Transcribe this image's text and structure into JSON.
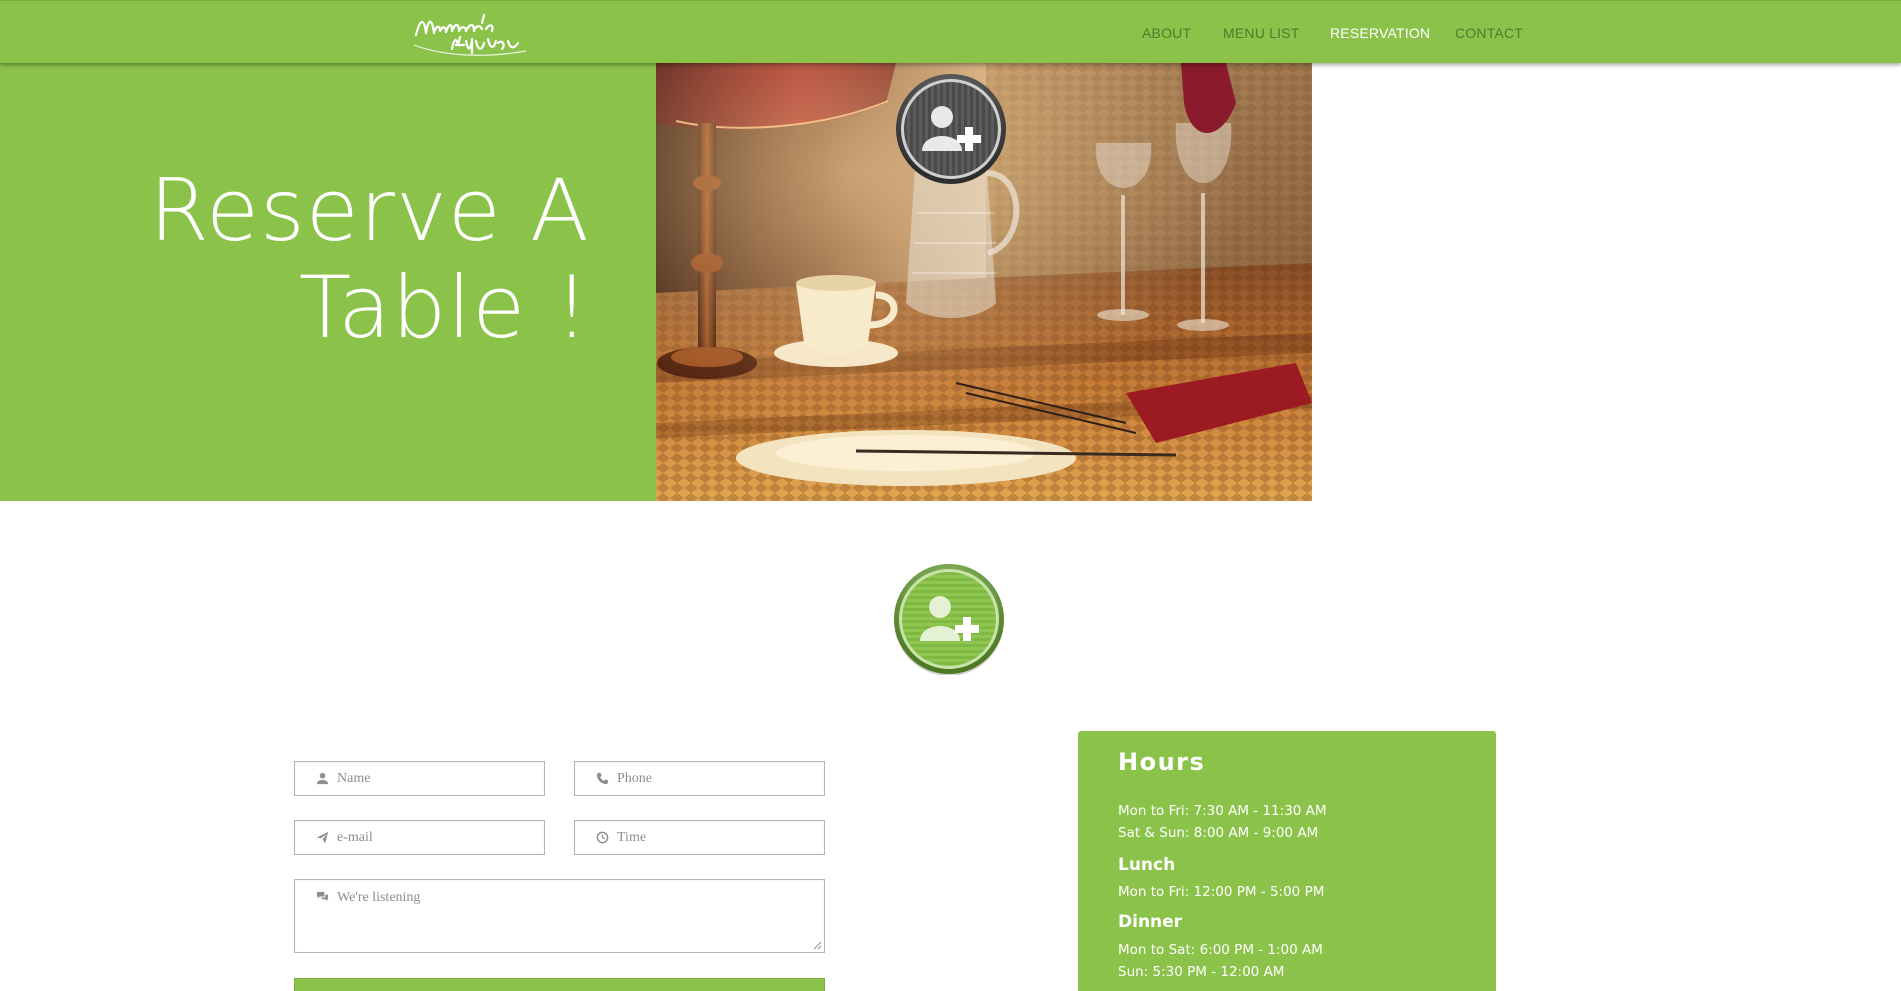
{
  "brand": {
    "logo_text": "Mamma's Kitchen"
  },
  "nav": {
    "items": [
      {
        "label": "ABOUT",
        "active": false
      },
      {
        "label": "MENU LIST",
        "active": false
      },
      {
        "label": "RESERVATION",
        "active": true
      },
      {
        "label": "CONTACT",
        "active": false
      }
    ]
  },
  "hero": {
    "title_line1": "Reserve A",
    "title_line2": "Table !",
    "photo": "restaurant-table-setting-photo",
    "badge_icon": "add-user-icon"
  },
  "section_icon": "add-user-icon",
  "form": {
    "name": {
      "placeholder": "Name",
      "icon": "user-icon"
    },
    "phone": {
      "placeholder": "Phone",
      "icon": "phone-icon"
    },
    "email": {
      "placeholder": "e-mail",
      "icon": "paper-plane-icon"
    },
    "time": {
      "placeholder": "Time",
      "icon": "clock-icon"
    },
    "message": {
      "placeholder": "We're listening",
      "icon": "comments-icon"
    }
  },
  "hours": {
    "title": "Hours",
    "breakfast": [
      "Mon to Fri: 7:30 AM - 11:30 AM",
      "Sat & Sun: 8:00 AM - 9:00 AM"
    ],
    "lunch_title": "Lunch",
    "lunch": [
      "Mon to Fri: 12:00 PM - 5:00 PM"
    ],
    "dinner_title": "Dinner",
    "dinner": [
      "Mon to Sat: 6:00 PM - 1:00 AM",
      "Sun: 5:30 PM - 12:00 AM"
    ]
  },
  "colors": {
    "brand_green": "#8bc34a",
    "nav_text": "#4f7a2c",
    "nav_active": "#ffffff"
  }
}
